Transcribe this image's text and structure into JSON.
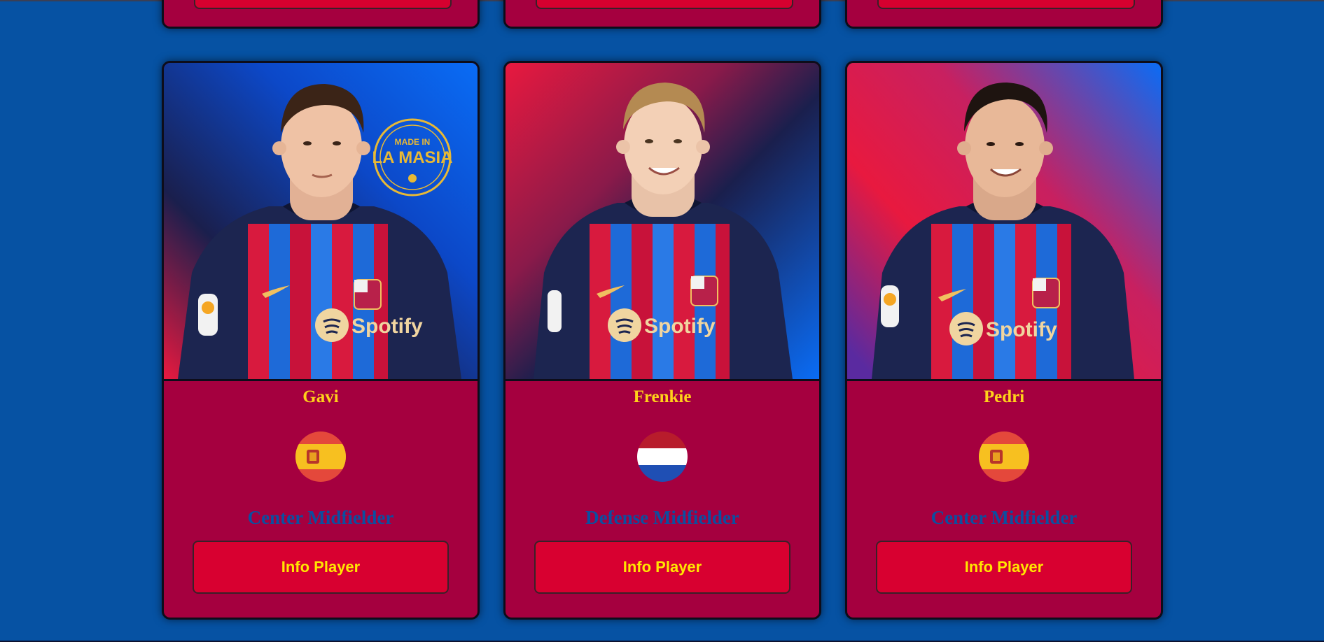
{
  "colors": {
    "page_background": "#0652a3",
    "card_background": "#a5003f",
    "name_color": "#ffd21a",
    "position_color": "#0b4fa0",
    "button_background": "#d80030",
    "button_text": "#ffe600"
  },
  "players": [
    {
      "name": "Gavi",
      "position": "Center Midfielder",
      "flag": "spain-flag-icon",
      "button_label": "Info Player",
      "photo_badge": "MADE IN LA MASIA",
      "jersey_sponsor": "Spotify"
    },
    {
      "name": "Frenkie",
      "position": "Defense Midfielder",
      "flag": "netherlands-flag-icon",
      "button_label": "Info Player",
      "jersey_sponsor": "Spotify"
    },
    {
      "name": "Pedri",
      "position": "Center Midfielder",
      "flag": "spain-flag-icon",
      "button_label": "Info Player",
      "jersey_sponsor": "Spotify"
    }
  ]
}
